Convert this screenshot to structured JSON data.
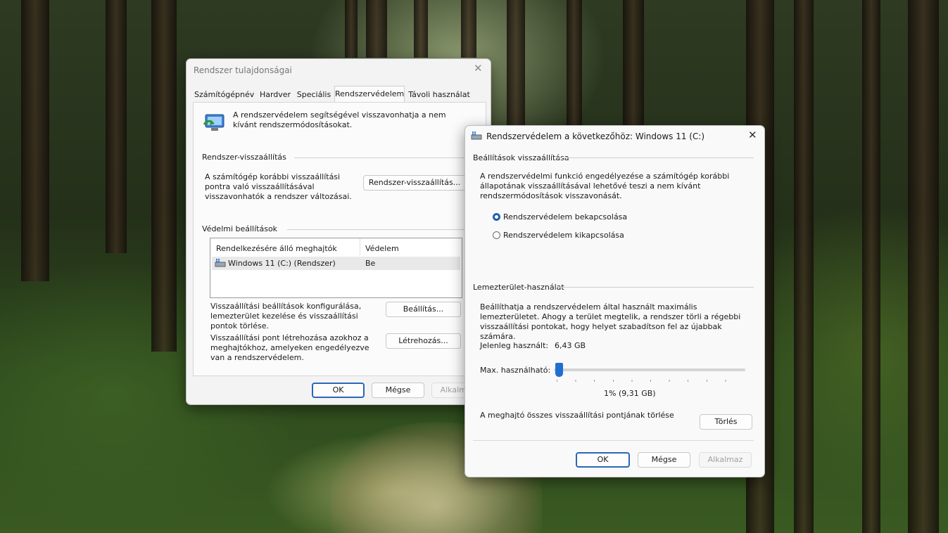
{
  "window1": {
    "title": "Rendszer tulajdonságai",
    "tabs": [
      "Számítógépnév",
      "Hardver",
      "Speciális",
      "Rendszervédelem",
      "Távoli használat"
    ],
    "info_text": "A rendszervédelem segítségével visszavonhatja a nem kívánt rendszermódosításokat.",
    "restore_group": "Rendszer-visszaállítás",
    "restore_text": "A számítógép korábbi visszaállítási pontra való visszaállításával visszavonhatók a rendszer változásai.",
    "restore_button": "Rendszer-visszaállítás...",
    "protection_group": "Védelmi beállítások",
    "table_headers": [
      "Rendelkezésére álló meghajtók",
      "Védelem"
    ],
    "table_rows": [
      {
        "drive": "Windows 11 (C:) (Rendszer)",
        "protection": "Be"
      }
    ],
    "configure_text": "Visszaállítási beállítások konfigurálása, lemezterület kezelése és visszaállítási pontok törlése.",
    "configure_button": "Beállítás...",
    "create_text": "Visszaállítási pont létrehozása azokhoz a meghajtókhoz, amelyeken engedélyezve van a rendszervédelem.",
    "create_button": "Létrehozás...",
    "ok": "OK",
    "cancel": "Mégse",
    "apply": "Alkalmaz"
  },
  "window2": {
    "title": "Rendszervédelem a következőhöz: Windows 11 (C:)",
    "restore_settings_group": "Beállítások visszaállítása",
    "restore_settings_text": "A rendszervédelmi funkció engedélyezése a számítógép korábbi állapotának visszaállításával lehetővé teszi a nem kívánt rendszermódosítások visszavonását.",
    "radio_on": "Rendszervédelem bekapcsolása",
    "radio_off": "Rendszervédelem kikapcsolása",
    "selected": "on",
    "disk_group": "Lemezterület-használat",
    "disk_text": "Beállíthatja a rendszervédelem által használt maximális lemezterületet. Ahogy a terület megtelik, a rendszer törli a régebbi visszaállítási pontokat, hogy helyet szabadítson fel az újabbak számára.",
    "current_label": "Jelenleg használt:",
    "current_value": "6,43 GB",
    "max_label": "Max. használható:",
    "slider_percent": 1,
    "slider_value_text": "1% (9,31 GB)",
    "delete_text": "A meghajtó összes visszaállítási pontjának törlése",
    "delete_button": "Törlés",
    "ok": "OK",
    "cancel": "Mégse",
    "apply": "Alkalmaz"
  },
  "colors": {
    "accent": "#1f5fb3",
    "slider_thumb": "#1f6fd1"
  }
}
